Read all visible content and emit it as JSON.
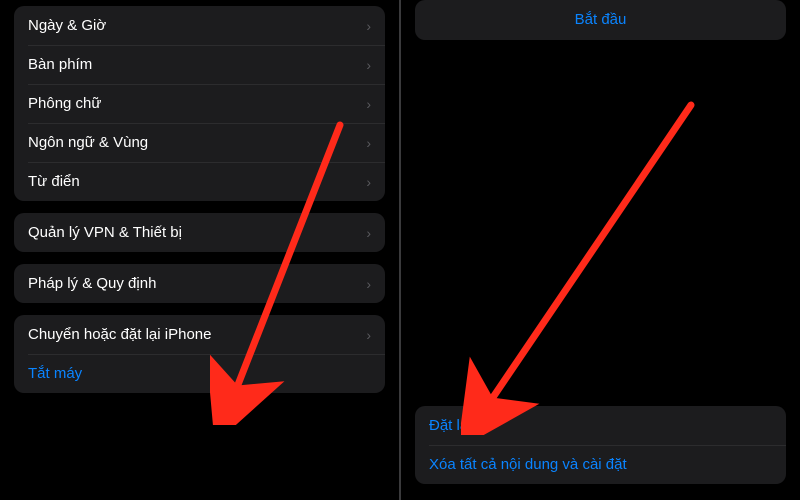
{
  "left": {
    "group1": [
      {
        "label": "Ngày & Giờ"
      },
      {
        "label": "Bàn phím"
      },
      {
        "label": "Phông chữ"
      },
      {
        "label": "Ngôn ngữ & Vùng"
      },
      {
        "label": "Từ điển"
      }
    ],
    "group2": [
      {
        "label": "Quản lý VPN & Thiết bị"
      }
    ],
    "group3": [
      {
        "label": "Pháp lý & Quy định"
      }
    ],
    "group4": [
      {
        "label": "Chuyển hoặc đặt lại iPhone"
      }
    ],
    "shutdown": "Tắt máy"
  },
  "right": {
    "start": "Bắt đầu",
    "reset": "Đặt lại",
    "erase": "Xóa tất cả nội dung và cài đặt"
  },
  "colors": {
    "accent": "#0a84ff",
    "arrow": "#ff2a1a"
  }
}
